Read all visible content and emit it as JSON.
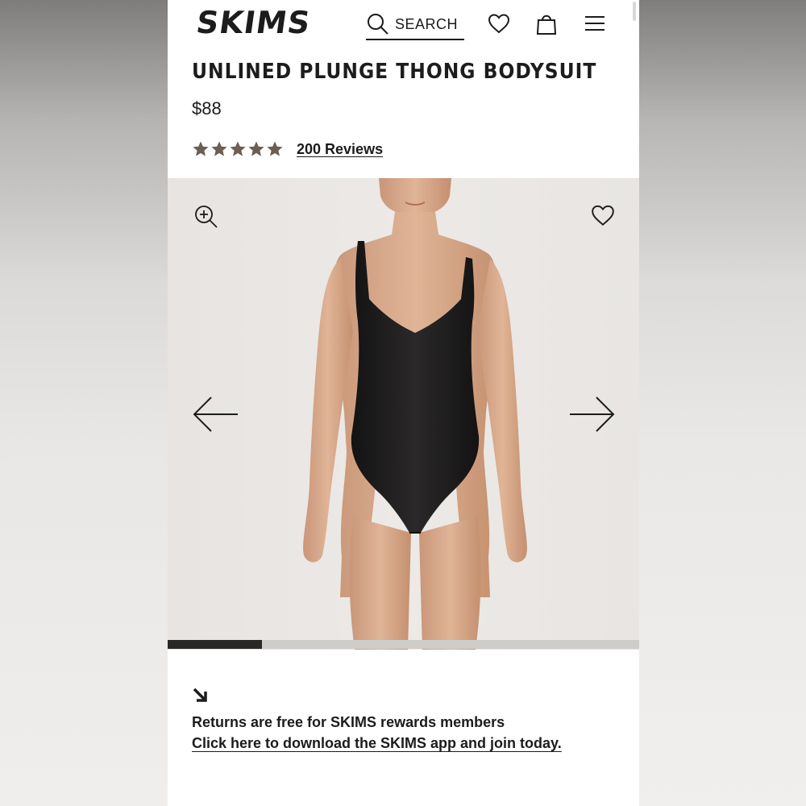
{
  "header": {
    "logo": "SKIMS",
    "search_label": "SEARCH"
  },
  "product": {
    "title": "UNLINED PLUNGE THONG BODYSUIT",
    "price": "$88",
    "rating": 5,
    "reviews_label": "200 Reviews"
  },
  "gallery": {
    "progress_fraction": 0.2
  },
  "returns": {
    "line1": "Returns are free for SKIMS rewards members",
    "line2": "Click here to download the SKIMS app and join today."
  },
  "colors": {
    "star": "#6b5f55",
    "text": "#1c1c1c",
    "progress": "#2a2826",
    "bodysuit": "#1d1c1c"
  },
  "icons": [
    "search-icon",
    "heart-icon",
    "bag-icon",
    "menu-icon",
    "zoom-in-icon",
    "wishlist-heart-icon",
    "arrow-left-icon",
    "arrow-right-icon",
    "arrow-down-right-icon"
  ]
}
